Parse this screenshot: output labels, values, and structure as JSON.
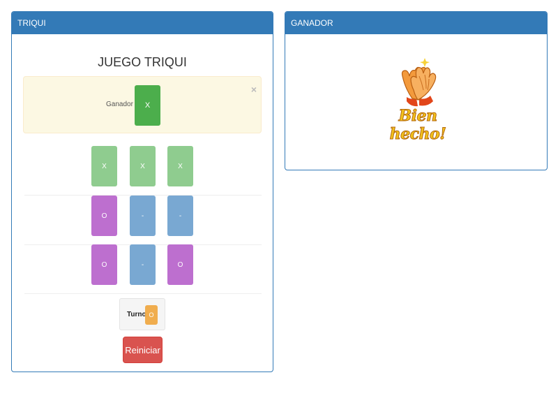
{
  "left_panel": {
    "title": "TRIQUI"
  },
  "right_panel": {
    "title": "GANADOR",
    "image_text": "Bien hecho!"
  },
  "game": {
    "title": "JUEGO TRIQUI",
    "alert": {
      "label": "Ganador",
      "winner": "X",
      "close": "×"
    },
    "board": [
      [
        "X",
        "X",
        "X"
      ],
      [
        "O",
        "-",
        "-"
      ],
      [
        "O",
        "-",
        "O"
      ]
    ],
    "turn": {
      "label": "Turno:",
      "value": "O"
    },
    "reset_label": "Reiniciar"
  },
  "colors": {
    "primary": "#337ab7",
    "x_cell": "#8fcc8f",
    "o_cell": "#bd6fcf",
    "empty_cell": "#79a8d2",
    "winner_badge": "#4cae4c",
    "turn_badge": "#f0ad4e",
    "danger": "#d9534f"
  }
}
